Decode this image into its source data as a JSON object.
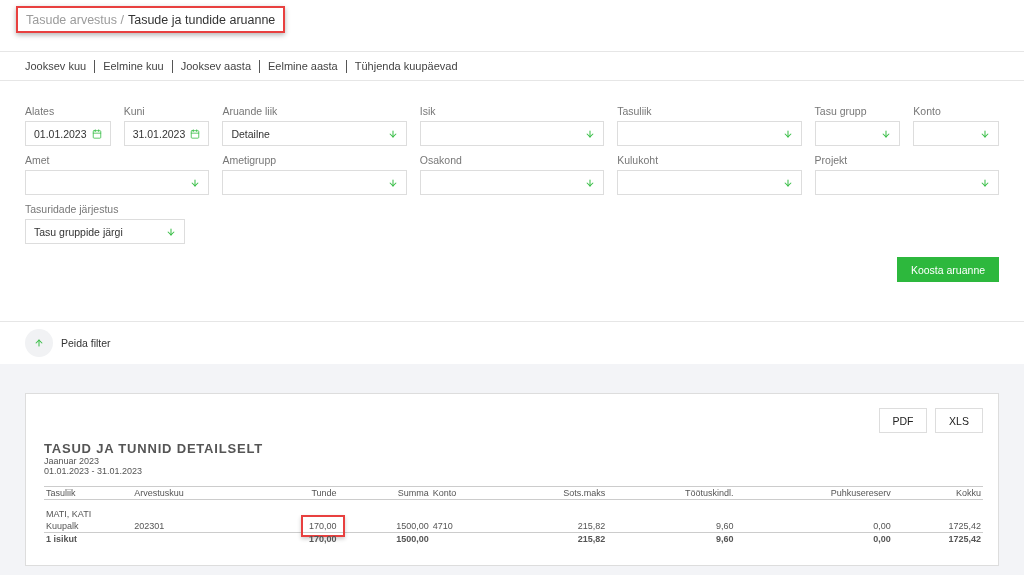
{
  "breadcrumb": {
    "parent": "Tasude arvestus /",
    "current": "Tasude ja tundide aruanne",
    "highlighted": true
  },
  "quick_links": [
    "Jooksev kuu",
    "Eelmine kuu",
    "Jooksev aasta",
    "Eelmine aasta",
    "Tühjenda kuupäevad"
  ],
  "filters": [
    {
      "label": "Alates",
      "kind": "date",
      "value": "01.01.2023"
    },
    {
      "label": "Kuni",
      "kind": "date",
      "value": "31.01.2023"
    },
    {
      "label": "Aruande liik",
      "kind": "select",
      "value": "Detailne"
    },
    {
      "label": "Isik",
      "kind": "select"
    },
    {
      "label": "Tasuliik",
      "kind": "select"
    },
    {
      "label": "Tasu grupp",
      "kind": "select"
    },
    {
      "label": "Konto",
      "kind": "select"
    },
    {
      "label": "Amet",
      "kind": "select"
    },
    {
      "label": "Ametigrupp",
      "kind": "select"
    },
    {
      "label": "Osakond",
      "kind": "select"
    },
    {
      "label": "Kulukoht",
      "kind": "select"
    },
    {
      "label": "Projekt",
      "kind": "select"
    },
    {
      "label": "Tasuridade järjestus",
      "kind": "select",
      "value": "Tasu gruppide järgi"
    }
  ],
  "submit_button": "Koosta aruanne",
  "toggle_filter": "Peida filter",
  "report": {
    "exports": [
      "PDF",
      "XLS"
    ],
    "title": "TASUD JA TUNNID DETAILSELT",
    "period": "Jaanuar 2023",
    "dates": "01.01.2023 - 31.01.2023",
    "columns": [
      "Tasuliik",
      "Arvestuskuu",
      "Tunde",
      "Summa",
      "Konto",
      "Sots.maks",
      "Töötuskindl.",
      "Puhkusereserv",
      "Kokku"
    ],
    "person": "MATI, KATI",
    "rows": [
      {
        "kind": "detail",
        "cells": [
          {
            "text": "Kuupalk",
            "highlighted": false
          },
          {
            "text": "202301",
            "highlighted": false
          },
          {
            "text": "170,00",
            "highlighted": true
          },
          {
            "text": "1500,00",
            "highlighted": false
          },
          {
            "text": "4710",
            "highlighted": false
          },
          {
            "text": "215,82",
            "highlighted": false
          },
          {
            "text": "9,60",
            "highlighted": false
          },
          {
            "text": "0,00",
            "highlighted": false
          },
          {
            "text": "1725,42",
            "highlighted": false
          }
        ]
      },
      {
        "kind": "total",
        "cells": [
          {
            "text": "1 isikut",
            "highlighted": false
          },
          null,
          {
            "text": "170,00",
            "highlighted": false
          },
          {
            "text": "1500,00",
            "highlighted": false
          },
          null,
          {
            "text": "215,82",
            "highlighted": false
          },
          {
            "text": "9,60",
            "highlighted": false
          },
          {
            "text": "0,00",
            "highlighted": false
          },
          {
            "text": "1725,42",
            "highlighted": false
          }
        ]
      }
    ]
  }
}
